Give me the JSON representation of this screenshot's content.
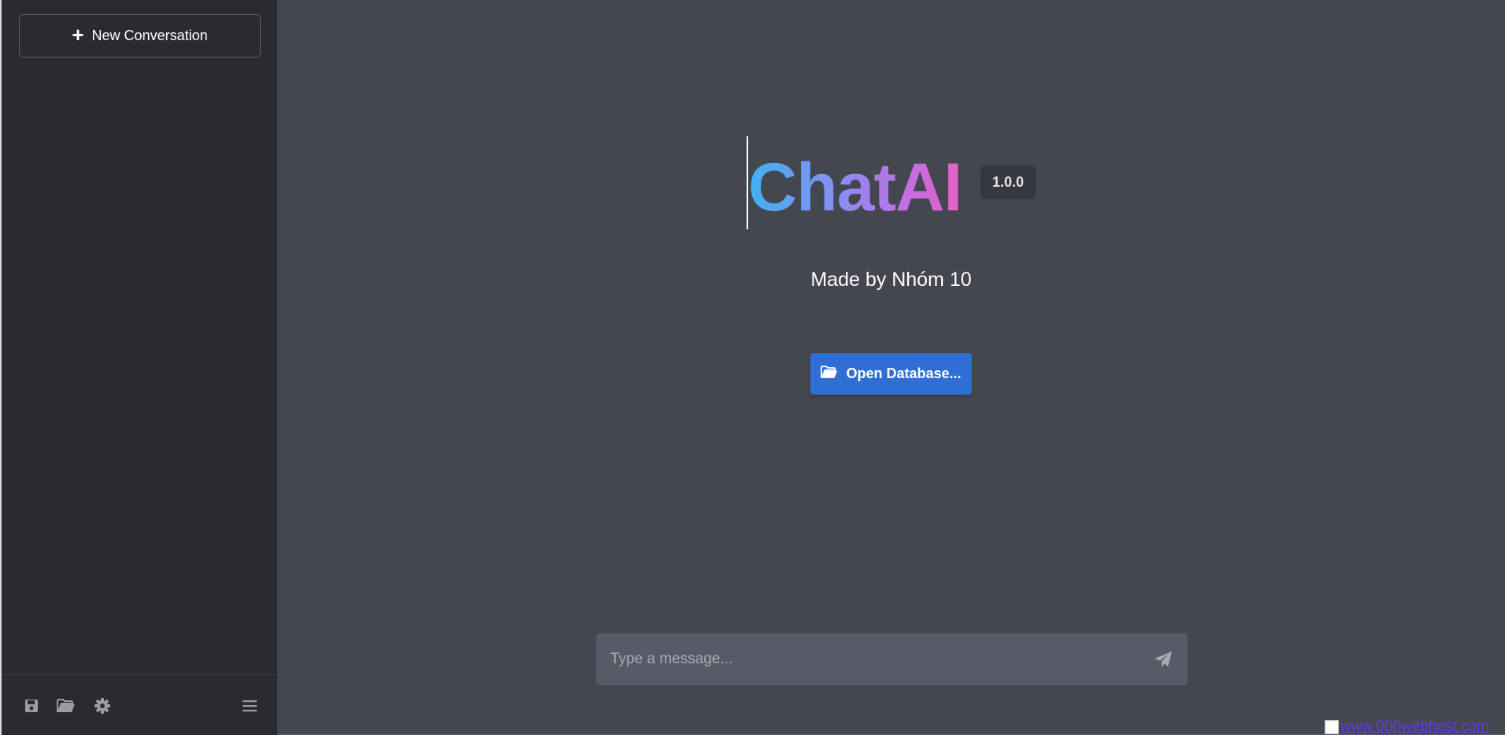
{
  "sidebar": {
    "new_conversation_label": "New Conversation",
    "footer_icons": [
      "save-icon",
      "folder-open-icon",
      "gear-icon",
      "menu-icon"
    ]
  },
  "main": {
    "logo_text": "ChatAI",
    "version": "1.0.0",
    "made_by": "Made by Nhóm 10",
    "open_database_label": "Open Database...",
    "composer": {
      "placeholder": "Type a message..."
    },
    "host_link_text": "www.000webhost.com"
  },
  "colors": {
    "sidebar_bg": "#292b30",
    "main_bg": "#444750",
    "composer_bg": "#585b67",
    "primary_button": "#2f6ed4",
    "logo_gradient": [
      "#3fb2ef",
      "#8b8cf0",
      "#c36ee3",
      "#e462c1"
    ]
  }
}
